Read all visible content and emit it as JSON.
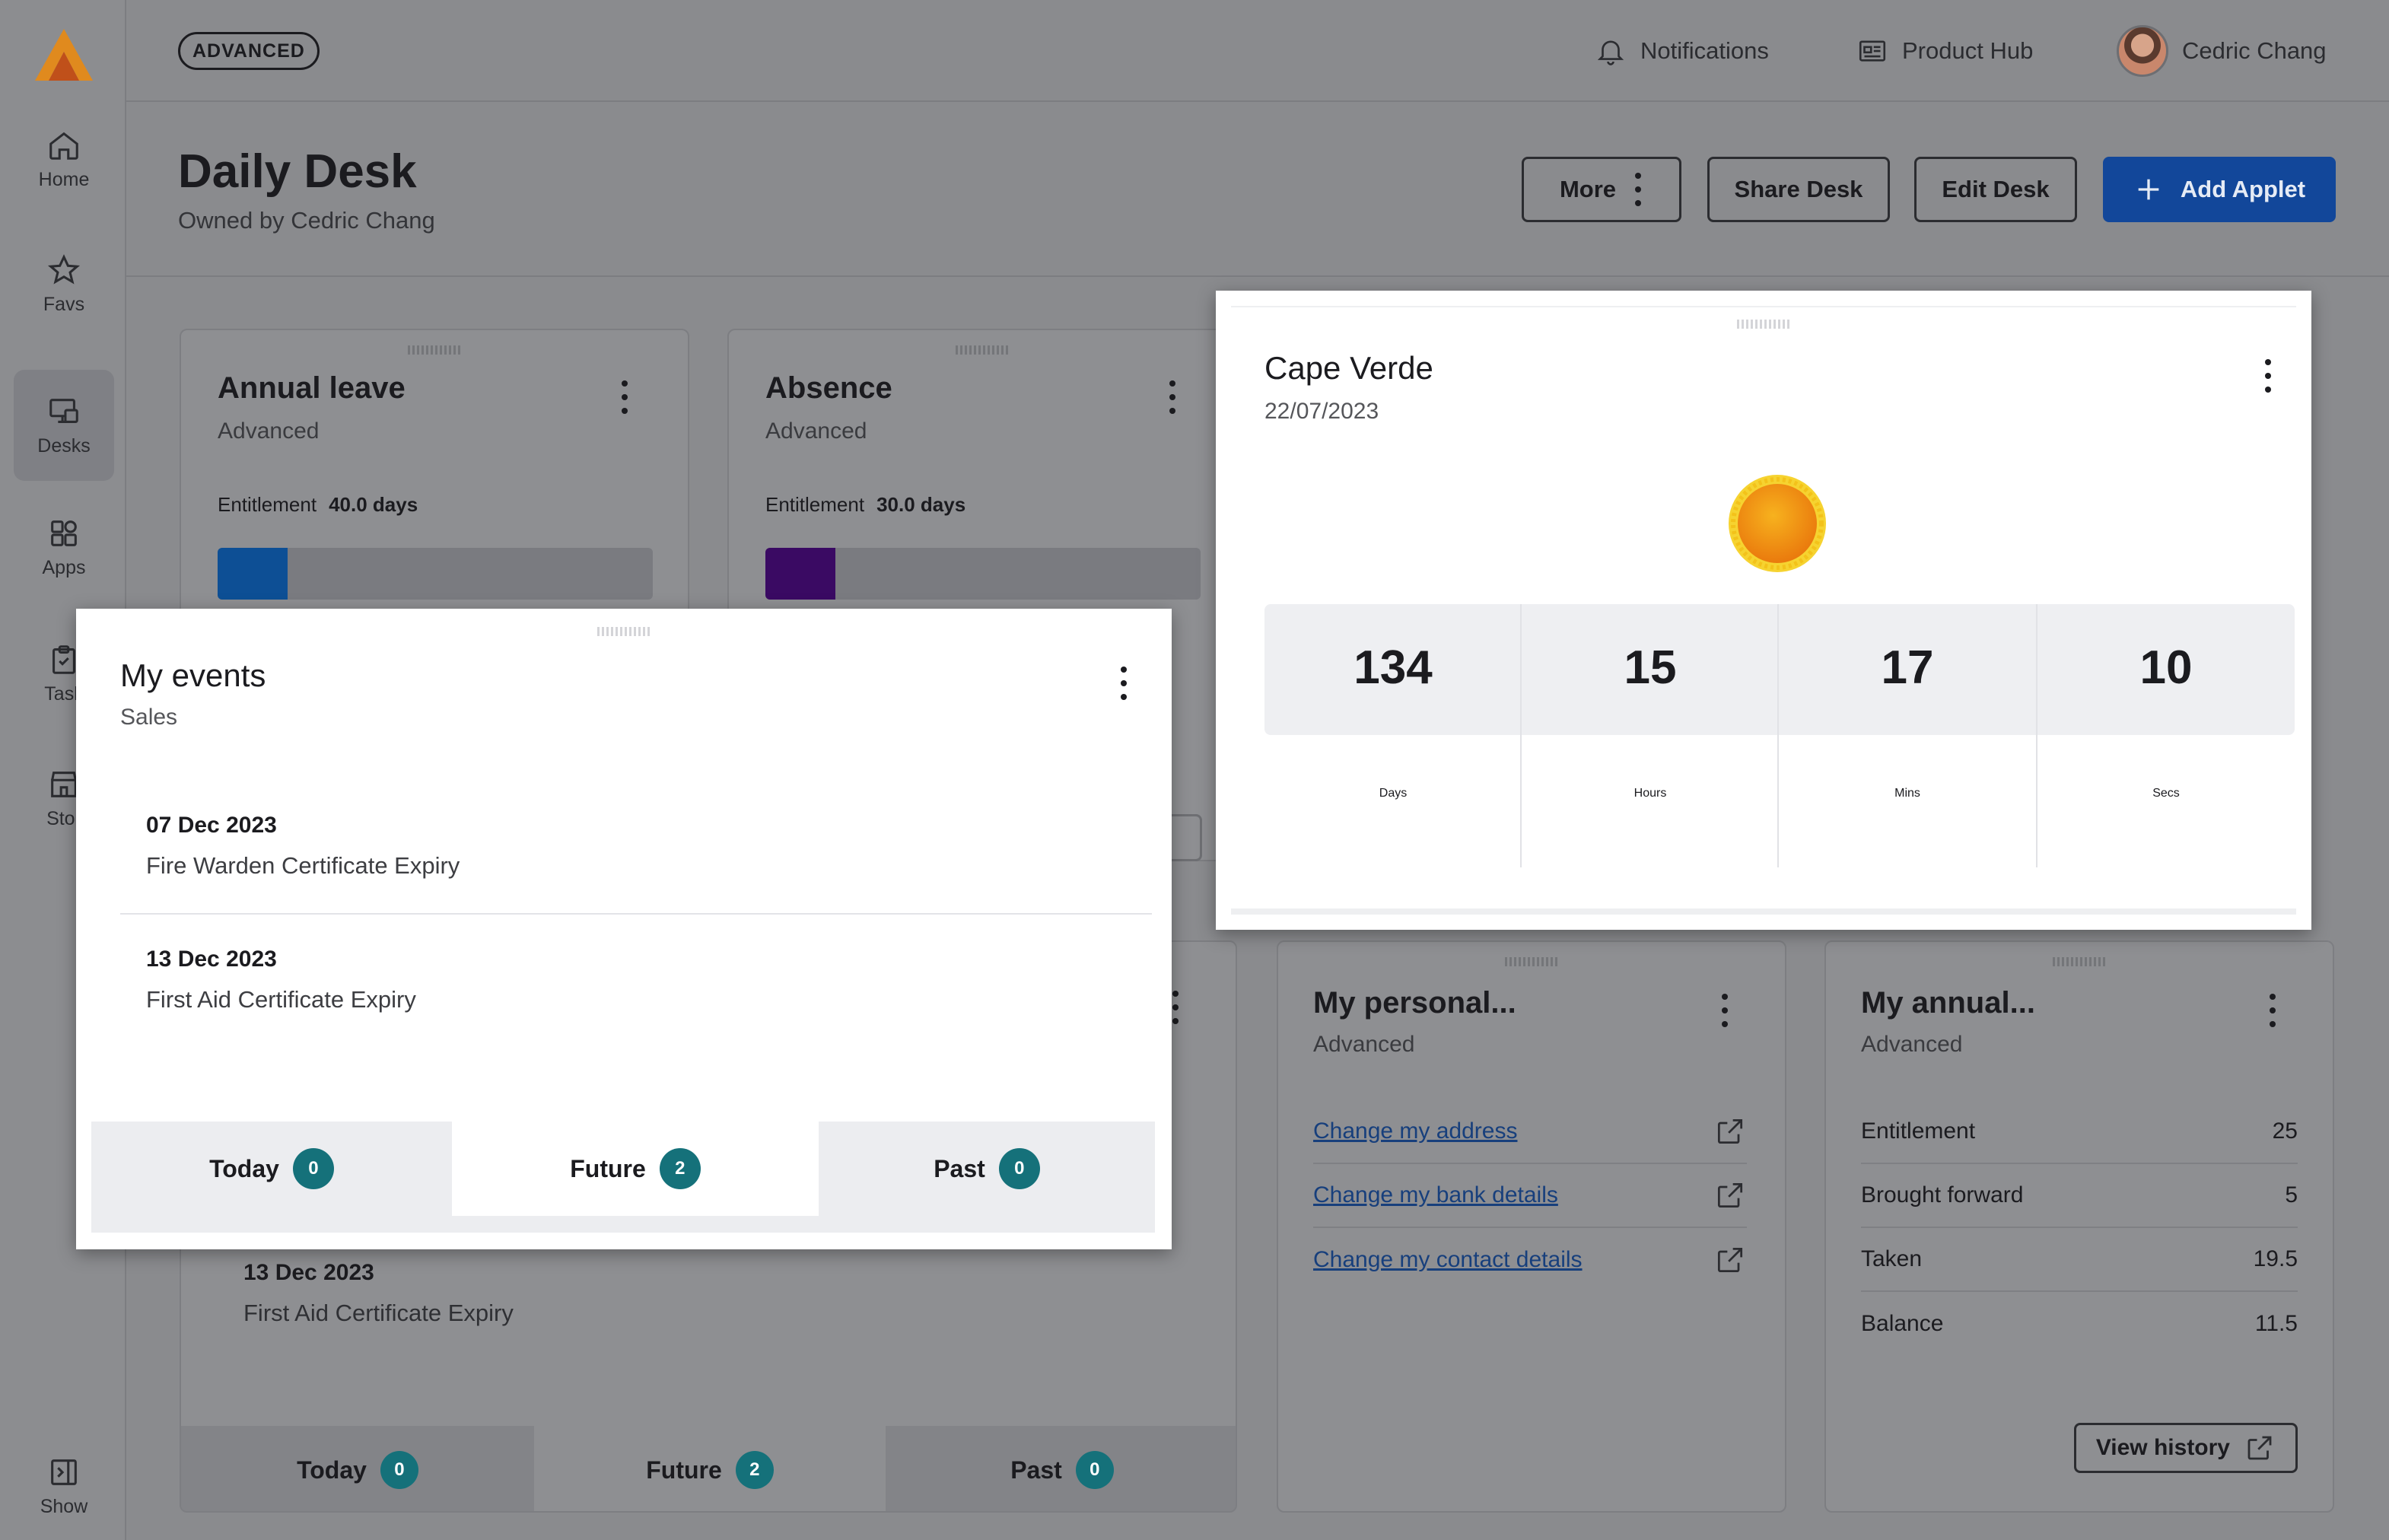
{
  "topbar": {
    "tier_badge": "ADVANCED",
    "notifications": "Notifications",
    "product_hub": "Product Hub",
    "user_name": "Cedric Chang"
  },
  "sidebar": {
    "items": [
      {
        "label": "Home",
        "icon": "home-icon"
      },
      {
        "label": "Favs",
        "icon": "star-icon"
      },
      {
        "label": "Desks",
        "icon": "desks-icon"
      },
      {
        "label": "Apps",
        "icon": "apps-icon"
      },
      {
        "label": "Task",
        "icon": "clipboard-icon"
      },
      {
        "label": "Stor",
        "icon": "store-icon"
      }
    ],
    "show_label": "Show"
  },
  "header": {
    "title": "Daily Desk",
    "owner": "Owned by Cedric Chang",
    "more_label": "More",
    "share_label": "Share Desk",
    "edit_label": "Edit Desk",
    "add_label": "Add Applet"
  },
  "annual_leave": {
    "title": "Annual leave",
    "subtitle": "Advanced",
    "ent_label": "Entitlement",
    "ent_value": "40.0 days",
    "progress": 0.16,
    "bar_color": "#0d4f95"
  },
  "absence": {
    "title": "Absence",
    "subtitle": "Advanced",
    "ent_label": "Entitlement",
    "ent_value": "30.0 days",
    "progress": 0.16,
    "bar_color": "#3a0a63"
  },
  "my_events": {
    "title": "My events",
    "subtitle": "Sales",
    "events": [
      {
        "date": "07 Dec 2023",
        "name": "Fire Warden Certificate Expiry"
      },
      {
        "date": "13 Dec 2023",
        "name": "First Aid Certificate Expiry"
      }
    ],
    "tabs": [
      {
        "label": "Today",
        "count": "0"
      },
      {
        "label": "Future",
        "count": "2"
      },
      {
        "label": "Past",
        "count": "0"
      }
    ]
  },
  "events_bg": {
    "event": {
      "date": "13 Dec 2023",
      "name": "First Aid Certificate Expiry"
    },
    "tabs": [
      {
        "label": "Today",
        "count": "0"
      },
      {
        "label": "Future",
        "count": "2"
      },
      {
        "label": "Past",
        "count": "0"
      }
    ]
  },
  "countdown": {
    "title": "Cape Verde",
    "date": "22/07/2023",
    "cells": [
      {
        "value": "134",
        "label": "Days"
      },
      {
        "value": "15",
        "label": "Hours"
      },
      {
        "value": "17",
        "label": "Mins"
      },
      {
        "value": "10",
        "label": "Secs"
      }
    ]
  },
  "personal": {
    "title": "My personal...",
    "subtitle": "Advanced",
    "links": [
      "Change my address",
      "Change my bank details",
      "Change my contact details"
    ]
  },
  "annual_summary": {
    "title": "My annual...",
    "subtitle": "Advanced",
    "rows": [
      {
        "label": "Entitlement",
        "value": "25"
      },
      {
        "label": "Brought forward",
        "value": "5"
      },
      {
        "label": "Taken",
        "value": "19.5"
      },
      {
        "label": "Balance",
        "value": "11.5"
      }
    ],
    "history_label": "View history"
  }
}
